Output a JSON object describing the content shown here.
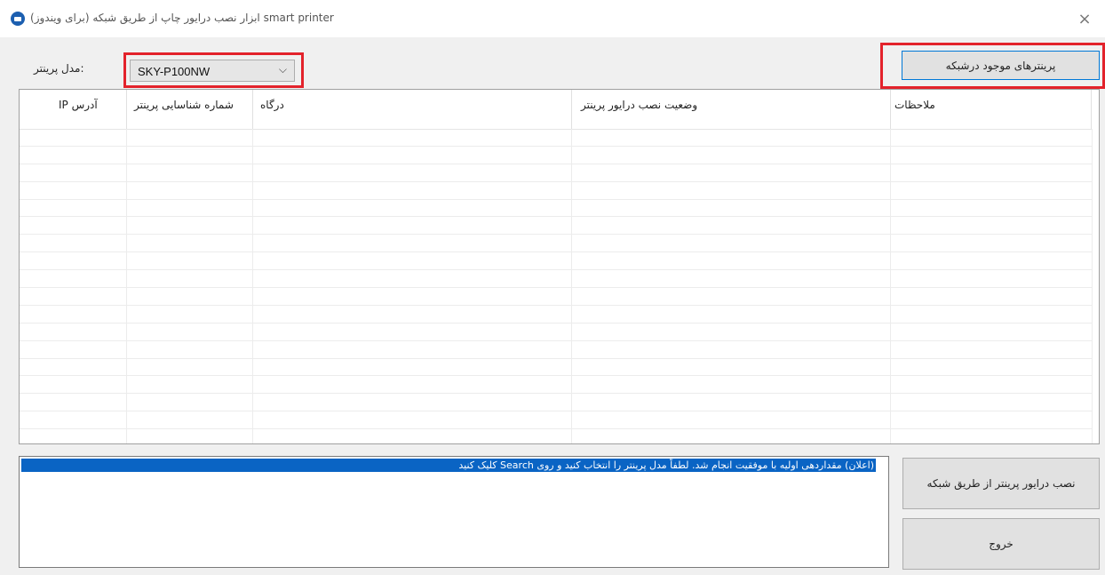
{
  "window": {
    "title": "(برای ویندوز) ابزار نصب درایور چاپ از طریق شبکه smart printer",
    "close_label": "×"
  },
  "model": {
    "label": "مدل پرینتر:",
    "selected": "SKY-P100NW",
    "chevron": "⌵"
  },
  "search_button": "پرینترهای موجود درشبکه",
  "table": {
    "columns": [
      "IP آدرس",
      "شماره شناسایی پرینتر",
      "درگاه",
      "وضعیت نصب درایور پرینتر",
      "ملاحظات"
    ],
    "rows": []
  },
  "log": {
    "lines": [
      "(اعلان) مقداردهی اولیه با موفقیت انجام شد. لطفاً مدل پرینتر را انتخاب کنید و روی Search کلیک کنید"
    ]
  },
  "buttons": {
    "install": "نصب درایور پرینتر از طریق شبکه",
    "exit": "خروج"
  }
}
